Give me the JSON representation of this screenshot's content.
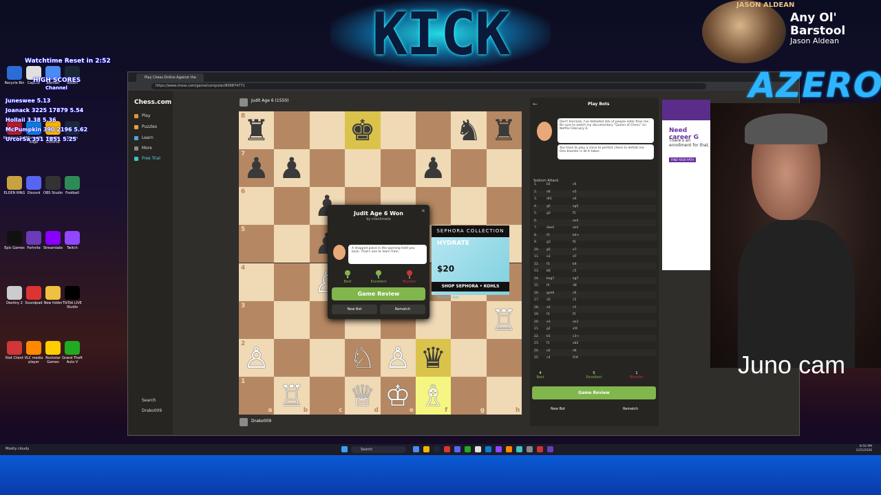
{
  "banner": {
    "logo_text": "KICK"
  },
  "now_playing": {
    "art_text": "JASON ALDEAN",
    "title": "Any Ol' Barstool",
    "artist": "Jason Aldean"
  },
  "stream_overlay": {
    "watchtime": "Watchtime Reset in 2:52",
    "high_scores": "HIGH SCORES",
    "channel": "Channel",
    "scores": [
      [
        "Juneswee",
        "5.13"
      ],
      [
        "Joanack",
        "3225",
        "17879",
        "5.54"
      ],
      [
        "Hollaii",
        "3.38",
        "5.36"
      ],
      [
        "McPumpkin",
        "390",
        "2196",
        "5.62"
      ],
      [
        "UrcorSa",
        "351",
        "1851",
        "5.25"
      ]
    ],
    "azeron": "AZERON",
    "cam_label": "Juno cam"
  },
  "desktop_icons": [
    "Recycle Bin",
    "CapCut",
    "Blender",
    "Steam",
    "Resident Evil",
    "Microsoft Edge",
    "Google Chrome",
    "Steam",
    "ELDEN RING",
    "Discord",
    "OBS Studio",
    "Football",
    "Epic Games",
    "Fortnite",
    "Streamlabs",
    "Twitch",
    "Destiny 2",
    "Soundpad",
    "New folder",
    "TikTok LIVE Studio",
    "Riot Client",
    "VLC media player",
    "Rockstar Games",
    "Grand Theft Auto V"
  ],
  "browser": {
    "tab_title": "Play Chess Online Against the Co...",
    "url": "https://www.chess.com/game/computer/809874771",
    "site_logo": "Chess.com",
    "nav": [
      "Play",
      "Puzzles",
      "Learn",
      "More",
      "Free Trial"
    ],
    "nav_bottom": [
      "Search",
      "Drako009"
    ]
  },
  "game": {
    "top_player": "Judit Age 6 (1550)",
    "bottom_player": "Drako009",
    "ranks": [
      "8",
      "7",
      "6",
      "5",
      "4",
      "3",
      "2",
      "1"
    ],
    "files": [
      "a",
      "b",
      "c",
      "d",
      "e",
      "f",
      "g",
      "h"
    ],
    "pieces": [
      {
        "sq": "a8",
        "p": "♜",
        "c": "b"
      },
      {
        "sq": "d8",
        "p": "♚",
        "c": "b"
      },
      {
        "sq": "g8",
        "p": "♞",
        "c": "b"
      },
      {
        "sq": "h8",
        "p": "♜",
        "c": "b"
      },
      {
        "sq": "a7",
        "p": "♟",
        "c": "b"
      },
      {
        "sq": "b7",
        "p": "♟",
        "c": "b"
      },
      {
        "sq": "f7",
        "p": "♟",
        "c": "b"
      },
      {
        "sq": "c6",
        "p": "♟",
        "c": "b"
      },
      {
        "sq": "c5",
        "p": "♟",
        "c": "b"
      },
      {
        "sq": "c4",
        "p": "♙",
        "c": "w"
      },
      {
        "sq": "h3",
        "p": "♖",
        "c": "w"
      },
      {
        "sq": "a2",
        "p": "♙",
        "c": "w"
      },
      {
        "sq": "d2",
        "p": "♘",
        "c": "w"
      },
      {
        "sq": "e2",
        "p": "♙",
        "c": "w"
      },
      {
        "sq": "f2",
        "p": "♛",
        "c": "b"
      },
      {
        "sq": "b1",
        "p": "♖",
        "c": "w"
      },
      {
        "sq": "d1",
        "p": "♕",
        "c": "w"
      },
      {
        "sq": "e1",
        "p": "♔",
        "c": "w"
      },
      {
        "sq": "f1",
        "p": "♗",
        "c": "w"
      }
    ],
    "highlights": [
      "d8",
      "f2",
      "f1"
    ]
  },
  "modal": {
    "title": "Judit Age 6 Won",
    "subtitle": "by checkmate",
    "message": "A dropped piece in the opening held you back. That's one to learn from.",
    "stats": [
      {
        "n": "4",
        "label": "Best",
        "color": "#81b64c"
      },
      {
        "n": "5",
        "label": "Excellent",
        "color": "#81b64c"
      },
      {
        "n": "1",
        "label": "Blunder",
        "color": "#ca3431"
      }
    ],
    "review": "Game Review",
    "new_bot": "New Bot",
    "rematch": "Rematch"
  },
  "ad": {
    "brand": "SEPHORA COLLECTION",
    "product": "HYDRATE",
    "price": "$20",
    "footer": "SHOP SEPHORA • KOHLS",
    "remove": "Remove Ads"
  },
  "panel": {
    "header": "Play Bots",
    "bot_msg1": "Don't feel bad, I've defeated lots of people older than me. Be sure to watch my documentary \"Queen of Chess\" on Netflix February 6.",
    "bot_msg2": "You have to play a close to perfect chess to defeat me. One blunder is all it takes.",
    "opening": "Sodium Attack",
    "moves": [
      [
        "1.",
        "b5",
        "c6"
      ],
      [
        "2.",
        "d4",
        "e5"
      ],
      [
        "3.",
        "dt3",
        "e4"
      ],
      [
        "4.",
        "g5",
        "xg5"
      ],
      [
        "5.",
        "g3",
        "f5"
      ],
      [
        "6.",
        "",
        "xe4"
      ],
      [
        "7.",
        "dxe4",
        "xe4"
      ],
      [
        "8.",
        "f3",
        "b4+"
      ],
      [
        "9.",
        "g3",
        "f6"
      ],
      [
        "10.",
        "g5",
        "e7"
      ],
      [
        "11.",
        "e3",
        "d7"
      ],
      [
        "12.",
        "f3",
        "b4"
      ],
      [
        "13.",
        "b6",
        "c5"
      ],
      [
        "14.",
        "bxg7",
        "xg7"
      ],
      [
        "15.",
        "f4",
        "d8"
      ],
      [
        "16.",
        "gxh6",
        "c6"
      ],
      [
        "17.",
        "d3",
        "c5"
      ],
      [
        "18.",
        "a3",
        "c5"
      ],
      [
        "19.",
        "f3",
        "f5"
      ],
      [
        "20.",
        "e3",
        "xe3"
      ],
      [
        "21.",
        "g2",
        "xf4"
      ],
      [
        "22.",
        "b1",
        "c3+"
      ],
      [
        "23.",
        "f1",
        "xb2"
      ],
      [
        "24.",
        "e2",
        "d4"
      ],
      [
        "25.",
        "c4",
        "f2#"
      ]
    ],
    "stats": [
      {
        "n": "4",
        "label": "Best",
        "color": "#81b64c"
      },
      {
        "n": "5",
        "label": "Excellent",
        "color": "#81b64c"
      },
      {
        "n": "1",
        "label": "Blunder",
        "color": "#ca3431"
      }
    ],
    "review": "Game Review",
    "new_bot": "New Bot",
    "rematch": "Rematch"
  },
  "right_ad": {
    "title": "Need career G",
    "body": "There's an enrollment for that.",
    "cta": "FIND YOUR PATH"
  },
  "taskbar": {
    "weather": "Mostly cloudy",
    "search": "Search",
    "time": "8:50 PM",
    "date": "2/25/2026"
  }
}
